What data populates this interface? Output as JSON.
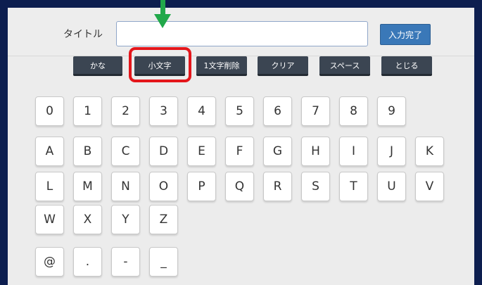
{
  "header": {
    "title_label": "タイトル",
    "title_input_value": "",
    "done_label": "入力完了"
  },
  "controls": {
    "kana": "かな",
    "lowercase": "小文字",
    "delete_one": "1文字削除",
    "clear": "クリア",
    "space": "スペース",
    "close": "とじる"
  },
  "keyboard": {
    "rows": [
      [
        "0",
        "1",
        "2",
        "3",
        "4",
        "5",
        "6",
        "7",
        "8",
        "9"
      ],
      [
        "A",
        "B",
        "C",
        "D",
        "E",
        "F",
        "G",
        "H",
        "I",
        "J",
        "K"
      ],
      [
        "L",
        "M",
        "N",
        "O",
        "P",
        "Q",
        "R",
        "S",
        "T",
        "U",
        "V"
      ],
      [
        "W",
        "X",
        "Y",
        "Z"
      ],
      [
        "@",
        ".",
        "-",
        "_"
      ]
    ]
  },
  "annotations": {
    "highlight_color": "#e4161b",
    "arrow_color": "#21a84a"
  }
}
